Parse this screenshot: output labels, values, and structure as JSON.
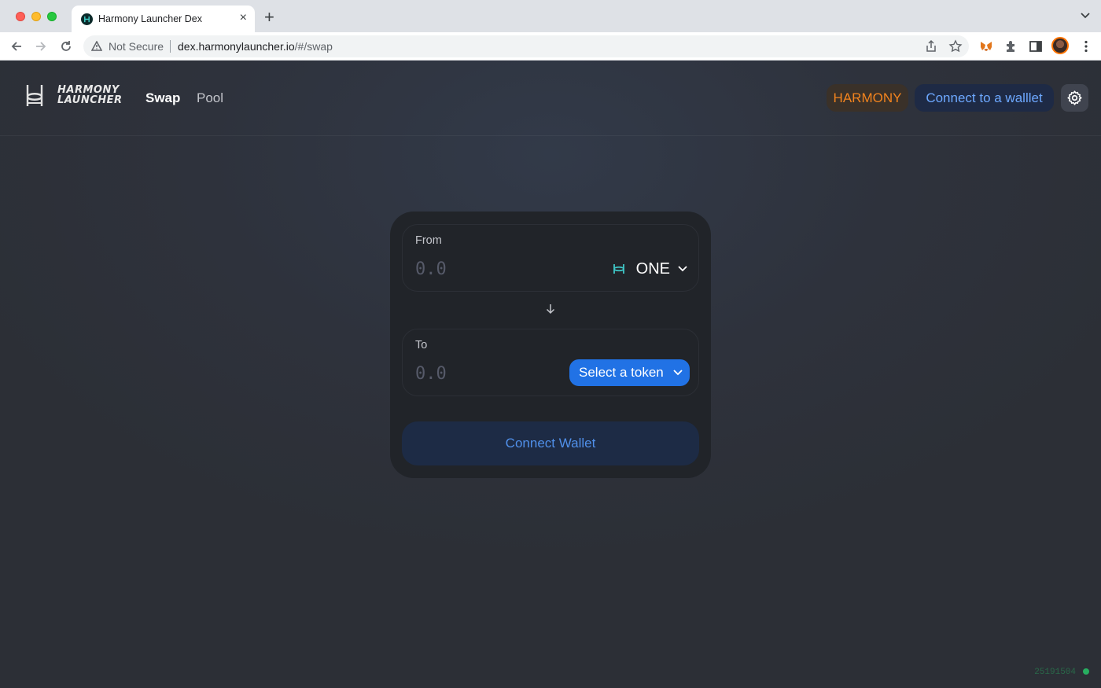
{
  "browser": {
    "tab_title": "Harmony Launcher Dex",
    "tab_close": "×",
    "new_tab": "+",
    "security_label": "Not Secure",
    "url_host": "dex.harmonylauncher.io",
    "url_path": "/#/swap",
    "icons": [
      "back-icon",
      "forward-icon",
      "reload-icon",
      "warning-icon",
      "share-icon",
      "star-icon",
      "metamask-icon",
      "extensions-icon",
      "sidebar-icon",
      "profile-avatar",
      "kebab-menu-icon"
    ]
  },
  "header": {
    "logo_line1": "HARMONY",
    "logo_line2": "LAUNCHER",
    "nav": {
      "swap": "Swap",
      "pool": "Pool"
    },
    "network": "HARMONY",
    "connect": "Connect to a walllet",
    "settings_icon": "gear-icon"
  },
  "swap": {
    "from": {
      "label": "From",
      "amount_placeholder": "0.0",
      "token": "ONE"
    },
    "to": {
      "label": "To",
      "amount_placeholder": "0.0",
      "select_label": "Select a token"
    },
    "connect_wallet": "Connect Wallet"
  },
  "footer": {
    "block_number": "25191504"
  },
  "colors": {
    "accent": "#2172e5",
    "network": "#f3841e",
    "status": "#27ae60",
    "background": "#2c2f36",
    "card": "#212429"
  }
}
